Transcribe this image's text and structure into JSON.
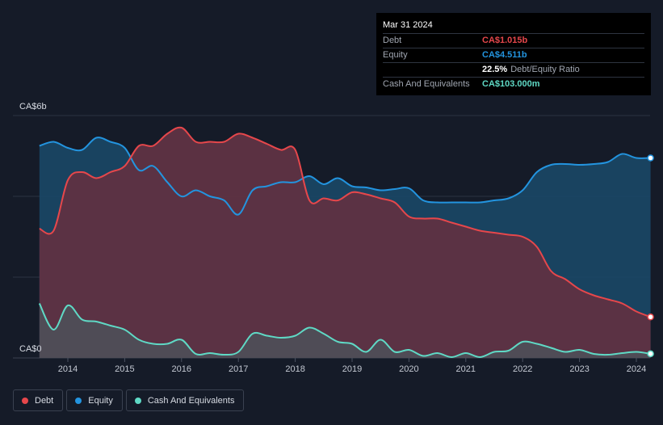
{
  "chart_data": {
    "type": "area",
    "y_unit_label_top": "CA$6b",
    "y_unit_label_bottom": "CA$0",
    "ylim": [
      0,
      6
    ],
    "xlim": [
      2013.5,
      2024.25
    ],
    "x_ticks": [
      "2014",
      "2015",
      "2016",
      "2017",
      "2018",
      "2019",
      "2020",
      "2021",
      "2022",
      "2023",
      "2024"
    ],
    "grid": true,
    "legend_position": "bottom-left",
    "series": [
      {
        "name": "Equity",
        "color": "#2394df",
        "points": [
          [
            2013.5,
            5.25
          ],
          [
            2013.75,
            5.35
          ],
          [
            2014.0,
            5.2
          ],
          [
            2014.25,
            5.15
          ],
          [
            2014.5,
            5.45
          ],
          [
            2014.75,
            5.35
          ],
          [
            2015.0,
            5.2
          ],
          [
            2015.25,
            4.65
          ],
          [
            2015.5,
            4.75
          ],
          [
            2015.75,
            4.35
          ],
          [
            2016.0,
            4.0
          ],
          [
            2016.25,
            4.15
          ],
          [
            2016.5,
            4.0
          ],
          [
            2016.75,
            3.9
          ],
          [
            2017.0,
            3.55
          ],
          [
            2017.25,
            4.15
          ],
          [
            2017.5,
            4.25
          ],
          [
            2017.75,
            4.35
          ],
          [
            2018.0,
            4.35
          ],
          [
            2018.25,
            4.5
          ],
          [
            2018.5,
            4.3
          ],
          [
            2018.75,
            4.45
          ],
          [
            2019.0,
            4.25
          ],
          [
            2019.25,
            4.22
          ],
          [
            2019.5,
            4.15
          ],
          [
            2019.75,
            4.18
          ],
          [
            2020.0,
            4.2
          ],
          [
            2020.25,
            3.9
          ],
          [
            2020.5,
            3.85
          ],
          [
            2020.75,
            3.85
          ],
          [
            2021.0,
            3.85
          ],
          [
            2021.25,
            3.85
          ],
          [
            2021.5,
            3.9
          ],
          [
            2021.75,
            3.95
          ],
          [
            2022.0,
            4.15
          ],
          [
            2022.25,
            4.6
          ],
          [
            2022.5,
            4.78
          ],
          [
            2022.75,
            4.8
          ],
          [
            2023.0,
            4.78
          ],
          [
            2023.25,
            4.8
          ],
          [
            2023.5,
            4.85
          ],
          [
            2023.75,
            5.05
          ],
          [
            2024.0,
            4.95
          ],
          [
            2024.25,
            4.95
          ]
        ]
      },
      {
        "name": "Debt",
        "color": "#e6474b",
        "points": [
          [
            2013.5,
            3.2
          ],
          [
            2013.75,
            3.15
          ],
          [
            2014.0,
            4.4
          ],
          [
            2014.25,
            4.6
          ],
          [
            2014.5,
            4.45
          ],
          [
            2014.75,
            4.6
          ],
          [
            2015.0,
            4.75
          ],
          [
            2015.25,
            5.25
          ],
          [
            2015.5,
            5.25
          ],
          [
            2015.75,
            5.55
          ],
          [
            2016.0,
            5.7
          ],
          [
            2016.25,
            5.35
          ],
          [
            2016.5,
            5.35
          ],
          [
            2016.75,
            5.35
          ],
          [
            2017.0,
            5.55
          ],
          [
            2017.25,
            5.45
          ],
          [
            2017.5,
            5.3
          ],
          [
            2017.75,
            5.15
          ],
          [
            2018.0,
            5.15
          ],
          [
            2018.25,
            3.9
          ],
          [
            2018.5,
            3.95
          ],
          [
            2018.75,
            3.9
          ],
          [
            2019.0,
            4.1
          ],
          [
            2019.25,
            4.05
          ],
          [
            2019.5,
            3.95
          ],
          [
            2019.75,
            3.85
          ],
          [
            2020.0,
            3.5
          ],
          [
            2020.25,
            3.45
          ],
          [
            2020.5,
            3.45
          ],
          [
            2020.75,
            3.35
          ],
          [
            2021.0,
            3.25
          ],
          [
            2021.25,
            3.15
          ],
          [
            2021.5,
            3.1
          ],
          [
            2021.75,
            3.05
          ],
          [
            2022.0,
            3.0
          ],
          [
            2022.25,
            2.75
          ],
          [
            2022.5,
            2.15
          ],
          [
            2022.75,
            1.95
          ],
          [
            2023.0,
            1.7
          ],
          [
            2023.25,
            1.55
          ],
          [
            2023.5,
            1.45
          ],
          [
            2023.75,
            1.35
          ],
          [
            2024.0,
            1.15
          ],
          [
            2024.25,
            1.015
          ]
        ]
      },
      {
        "name": "Cash And Equivalents",
        "color": "#5fd9c5",
        "points": [
          [
            2013.5,
            1.35
          ],
          [
            2013.75,
            0.7
          ],
          [
            2014.0,
            1.3
          ],
          [
            2014.25,
            0.95
          ],
          [
            2014.5,
            0.9
          ],
          [
            2014.75,
            0.8
          ],
          [
            2015.0,
            0.7
          ],
          [
            2015.25,
            0.45
          ],
          [
            2015.5,
            0.35
          ],
          [
            2015.75,
            0.35
          ],
          [
            2016.0,
            0.45
          ],
          [
            2016.25,
            0.1
          ],
          [
            2016.5,
            0.12
          ],
          [
            2016.75,
            0.08
          ],
          [
            2017.0,
            0.15
          ],
          [
            2017.25,
            0.6
          ],
          [
            2017.5,
            0.55
          ],
          [
            2017.75,
            0.5
          ],
          [
            2018.0,
            0.55
          ],
          [
            2018.25,
            0.75
          ],
          [
            2018.5,
            0.6
          ],
          [
            2018.75,
            0.4
          ],
          [
            2019.0,
            0.35
          ],
          [
            2019.25,
            0.15
          ],
          [
            2019.5,
            0.45
          ],
          [
            2019.75,
            0.15
          ],
          [
            2020.0,
            0.2
          ],
          [
            2020.25,
            0.05
          ],
          [
            2020.5,
            0.12
          ],
          [
            2020.75,
            0.02
          ],
          [
            2021.0,
            0.12
          ],
          [
            2021.25,
            0.02
          ],
          [
            2021.5,
            0.15
          ],
          [
            2021.75,
            0.18
          ],
          [
            2022.0,
            0.4
          ],
          [
            2022.25,
            0.35
          ],
          [
            2022.5,
            0.25
          ],
          [
            2022.75,
            0.15
          ],
          [
            2023.0,
            0.2
          ],
          [
            2023.25,
            0.1
          ],
          [
            2023.5,
            0.08
          ],
          [
            2023.75,
            0.12
          ],
          [
            2024.0,
            0.15
          ],
          [
            2024.25,
            0.103
          ]
        ]
      }
    ]
  },
  "tooltip": {
    "date": "Mar 31 2024",
    "rows": [
      {
        "label": "Debt",
        "value": "CA$1.015b",
        "extra": "",
        "color": "#e6474b"
      },
      {
        "label": "Equity",
        "value": "CA$4.511b",
        "extra": "",
        "color": "#2394df"
      },
      {
        "label": "",
        "value": "22.5%",
        "extra": "Debt/Equity Ratio",
        "color": "#ffffff"
      },
      {
        "label": "Cash And Equivalents",
        "value": "CA$103.000m",
        "extra": "",
        "color": "#5fd9c5"
      }
    ]
  },
  "legend": [
    {
      "label": "Debt",
      "color": "#e6474b"
    },
    {
      "label": "Equity",
      "color": "#2394df"
    },
    {
      "label": "Cash And Equivalents",
      "color": "#5fd9c5"
    }
  ]
}
